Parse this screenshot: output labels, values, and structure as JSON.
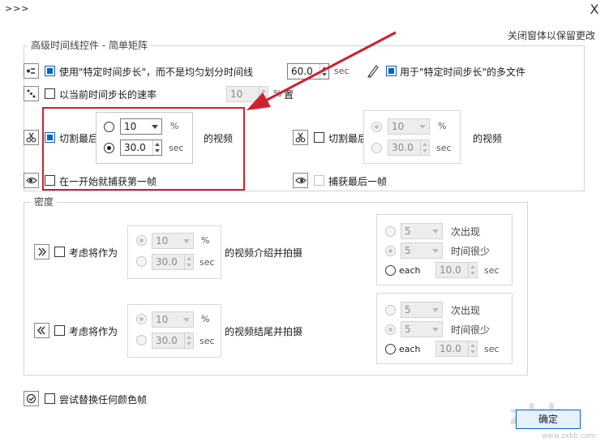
{
  "window": {
    "title": ">>>",
    "close": "X"
  },
  "top_link": "关闭窗体以保留更改",
  "advanced": {
    "legend": "高级时间线控件 - 简单矩阵",
    "fixed_step": {
      "label": "使用\"特定时间步长\"，而不是均匀划分时间线",
      "value": "60.0",
      "unit": "sec"
    },
    "multi_file": {
      "label": "用于\"特定时间步长\"的多文件"
    },
    "rate": {
      "label": "以当前时间步长的速率",
      "value": "10",
      "unit": "%",
      "unit_tail": "置"
    },
    "cut_left": {
      "label_prefix": "切割最后",
      "label_suffix": "的视频",
      "percent": {
        "value": "10",
        "unit": "%"
      },
      "seconds": {
        "value": "30.0",
        "unit": "sec"
      }
    },
    "cut_right": {
      "label_prefix": "切割最后",
      "label_suffix": "的视频",
      "percent": {
        "value": "10",
        "unit": "%"
      },
      "seconds": {
        "value": "30.0",
        "unit": "sec"
      }
    },
    "capture_first": {
      "label": "在一开始就捕获第一帧"
    },
    "capture_last": {
      "label": "捕获最后一帧"
    }
  },
  "density": {
    "legend": "密度",
    "intro": {
      "label": "考虑将作为",
      "suffix": "的视频介绍并拍摄",
      "percent": {
        "value": "10",
        "unit": "%"
      },
      "seconds": {
        "value": "30.0",
        "unit": "sec"
      },
      "right": {
        "occur": {
          "value": "5",
          "label": "次出现"
        },
        "rare": {
          "value": "5",
          "label": "时间很少"
        },
        "each": {
          "label": "each",
          "value": "10.0",
          "unit": "sec"
        }
      }
    },
    "outro": {
      "label": "考虑将作为",
      "suffix": "的视频结尾并拍摄",
      "percent": {
        "value": "10",
        "unit": "%"
      },
      "seconds": {
        "value": "30.0",
        "unit": "sec"
      },
      "right": {
        "occur": {
          "value": "5",
          "label": "次出现"
        },
        "rare": {
          "value": "5",
          "label": "时间很少"
        },
        "each": {
          "label": "each",
          "value": "10.0",
          "unit": "sec"
        }
      }
    }
  },
  "replace_color": {
    "label": "尝试替换任何颜色帧"
  },
  "ok_button": "确定",
  "watermark": {
    "main": "zkb",
    "sub": "www.zxkb.com"
  },
  "colors": {
    "accent": "#0a61c9",
    "highlight": "#d0202c",
    "frame": "#d4d4d4"
  },
  "icons": [
    "step-icon",
    "dots-icon",
    "pen-icon",
    "scissors-icon",
    "eye-icon",
    "forward-icon",
    "rewind-icon",
    "check-circle-icon"
  ]
}
